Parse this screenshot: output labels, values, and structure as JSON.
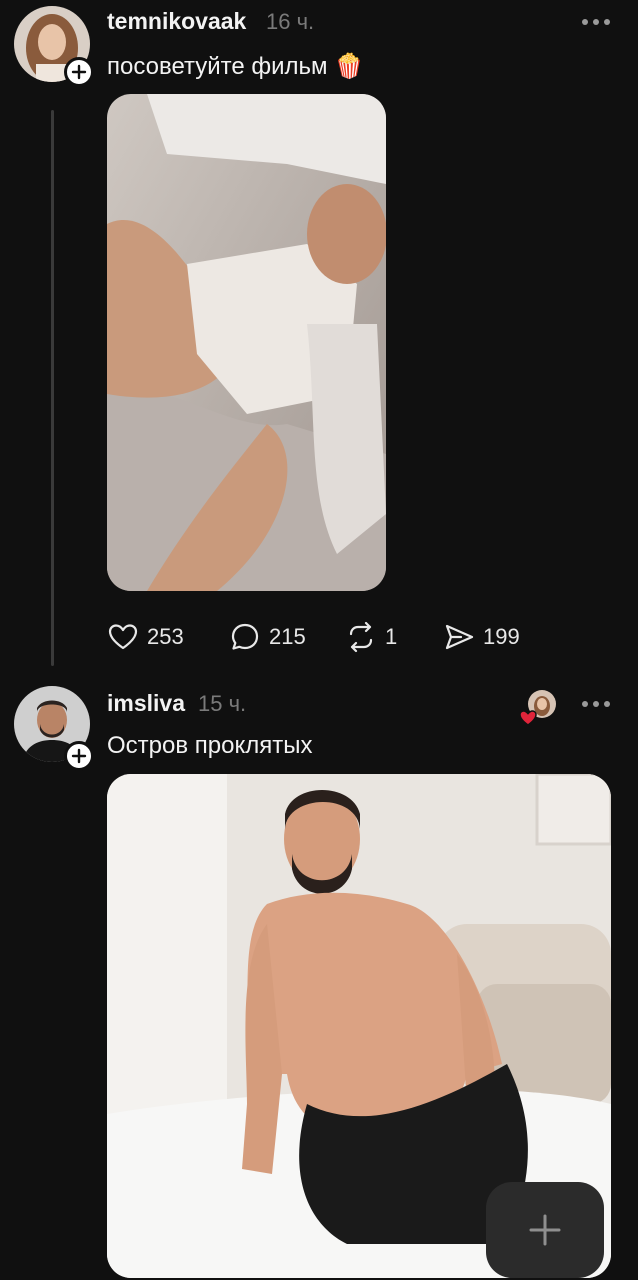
{
  "posts": [
    {
      "username": "temnikovaak",
      "time": "16 ч.",
      "text": "посоветуйте фильм",
      "emoji": "🍿",
      "stats": {
        "likes": "253",
        "comments": "215",
        "reposts": "1",
        "shares": "199"
      }
    },
    {
      "username": "imsliva",
      "time": "15 ч.",
      "text": "Остров проклятых"
    }
  ],
  "icons": {
    "more": "more-dots-icon",
    "like": "heart-icon",
    "comment": "comment-bubble-icon",
    "repost": "repost-icon",
    "share": "send-arrow-icon",
    "follow": "plus-icon",
    "compose": "plus-icon"
  },
  "colors": {
    "background": "#101010",
    "text": "#f3f3f3",
    "muted": "#7a7a7a",
    "like_red": "#e0243a"
  }
}
